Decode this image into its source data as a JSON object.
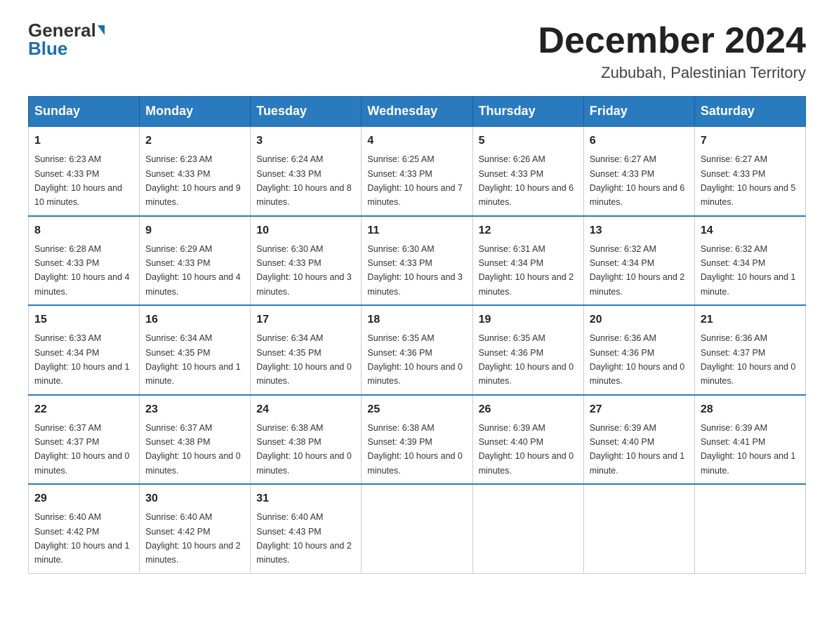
{
  "header": {
    "logo_general": "General",
    "logo_blue": "Blue",
    "month_title": "December 2024",
    "location": "Zububah, Palestinian Territory"
  },
  "days_of_week": [
    "Sunday",
    "Monday",
    "Tuesday",
    "Wednesday",
    "Thursday",
    "Friday",
    "Saturday"
  ],
  "weeks": [
    [
      {
        "num": "1",
        "sunrise": "6:23 AM",
        "sunset": "4:33 PM",
        "daylight": "10 hours and 10 minutes."
      },
      {
        "num": "2",
        "sunrise": "6:23 AM",
        "sunset": "4:33 PM",
        "daylight": "10 hours and 9 minutes."
      },
      {
        "num": "3",
        "sunrise": "6:24 AM",
        "sunset": "4:33 PM",
        "daylight": "10 hours and 8 minutes."
      },
      {
        "num": "4",
        "sunrise": "6:25 AM",
        "sunset": "4:33 PM",
        "daylight": "10 hours and 7 minutes."
      },
      {
        "num": "5",
        "sunrise": "6:26 AM",
        "sunset": "4:33 PM",
        "daylight": "10 hours and 6 minutes."
      },
      {
        "num": "6",
        "sunrise": "6:27 AM",
        "sunset": "4:33 PM",
        "daylight": "10 hours and 6 minutes."
      },
      {
        "num": "7",
        "sunrise": "6:27 AM",
        "sunset": "4:33 PM",
        "daylight": "10 hours and 5 minutes."
      }
    ],
    [
      {
        "num": "8",
        "sunrise": "6:28 AM",
        "sunset": "4:33 PM",
        "daylight": "10 hours and 4 minutes."
      },
      {
        "num": "9",
        "sunrise": "6:29 AM",
        "sunset": "4:33 PM",
        "daylight": "10 hours and 4 minutes."
      },
      {
        "num": "10",
        "sunrise": "6:30 AM",
        "sunset": "4:33 PM",
        "daylight": "10 hours and 3 minutes."
      },
      {
        "num": "11",
        "sunrise": "6:30 AM",
        "sunset": "4:33 PM",
        "daylight": "10 hours and 3 minutes."
      },
      {
        "num": "12",
        "sunrise": "6:31 AM",
        "sunset": "4:34 PM",
        "daylight": "10 hours and 2 minutes."
      },
      {
        "num": "13",
        "sunrise": "6:32 AM",
        "sunset": "4:34 PM",
        "daylight": "10 hours and 2 minutes."
      },
      {
        "num": "14",
        "sunrise": "6:32 AM",
        "sunset": "4:34 PM",
        "daylight": "10 hours and 1 minute."
      }
    ],
    [
      {
        "num": "15",
        "sunrise": "6:33 AM",
        "sunset": "4:34 PM",
        "daylight": "10 hours and 1 minute."
      },
      {
        "num": "16",
        "sunrise": "6:34 AM",
        "sunset": "4:35 PM",
        "daylight": "10 hours and 1 minute."
      },
      {
        "num": "17",
        "sunrise": "6:34 AM",
        "sunset": "4:35 PM",
        "daylight": "10 hours and 0 minutes."
      },
      {
        "num": "18",
        "sunrise": "6:35 AM",
        "sunset": "4:36 PM",
        "daylight": "10 hours and 0 minutes."
      },
      {
        "num": "19",
        "sunrise": "6:35 AM",
        "sunset": "4:36 PM",
        "daylight": "10 hours and 0 minutes."
      },
      {
        "num": "20",
        "sunrise": "6:36 AM",
        "sunset": "4:36 PM",
        "daylight": "10 hours and 0 minutes."
      },
      {
        "num": "21",
        "sunrise": "6:36 AM",
        "sunset": "4:37 PM",
        "daylight": "10 hours and 0 minutes."
      }
    ],
    [
      {
        "num": "22",
        "sunrise": "6:37 AM",
        "sunset": "4:37 PM",
        "daylight": "10 hours and 0 minutes."
      },
      {
        "num": "23",
        "sunrise": "6:37 AM",
        "sunset": "4:38 PM",
        "daylight": "10 hours and 0 minutes."
      },
      {
        "num": "24",
        "sunrise": "6:38 AM",
        "sunset": "4:38 PM",
        "daylight": "10 hours and 0 minutes."
      },
      {
        "num": "25",
        "sunrise": "6:38 AM",
        "sunset": "4:39 PM",
        "daylight": "10 hours and 0 minutes."
      },
      {
        "num": "26",
        "sunrise": "6:39 AM",
        "sunset": "4:40 PM",
        "daylight": "10 hours and 0 minutes."
      },
      {
        "num": "27",
        "sunrise": "6:39 AM",
        "sunset": "4:40 PM",
        "daylight": "10 hours and 1 minute."
      },
      {
        "num": "28",
        "sunrise": "6:39 AM",
        "sunset": "4:41 PM",
        "daylight": "10 hours and 1 minute."
      }
    ],
    [
      {
        "num": "29",
        "sunrise": "6:40 AM",
        "sunset": "4:42 PM",
        "daylight": "10 hours and 1 minute."
      },
      {
        "num": "30",
        "sunrise": "6:40 AM",
        "sunset": "4:42 PM",
        "daylight": "10 hours and 2 minutes."
      },
      {
        "num": "31",
        "sunrise": "6:40 AM",
        "sunset": "4:43 PM",
        "daylight": "10 hours and 2 minutes."
      },
      null,
      null,
      null,
      null
    ]
  ],
  "labels": {
    "sunrise": "Sunrise:",
    "sunset": "Sunset:",
    "daylight": "Daylight:"
  }
}
